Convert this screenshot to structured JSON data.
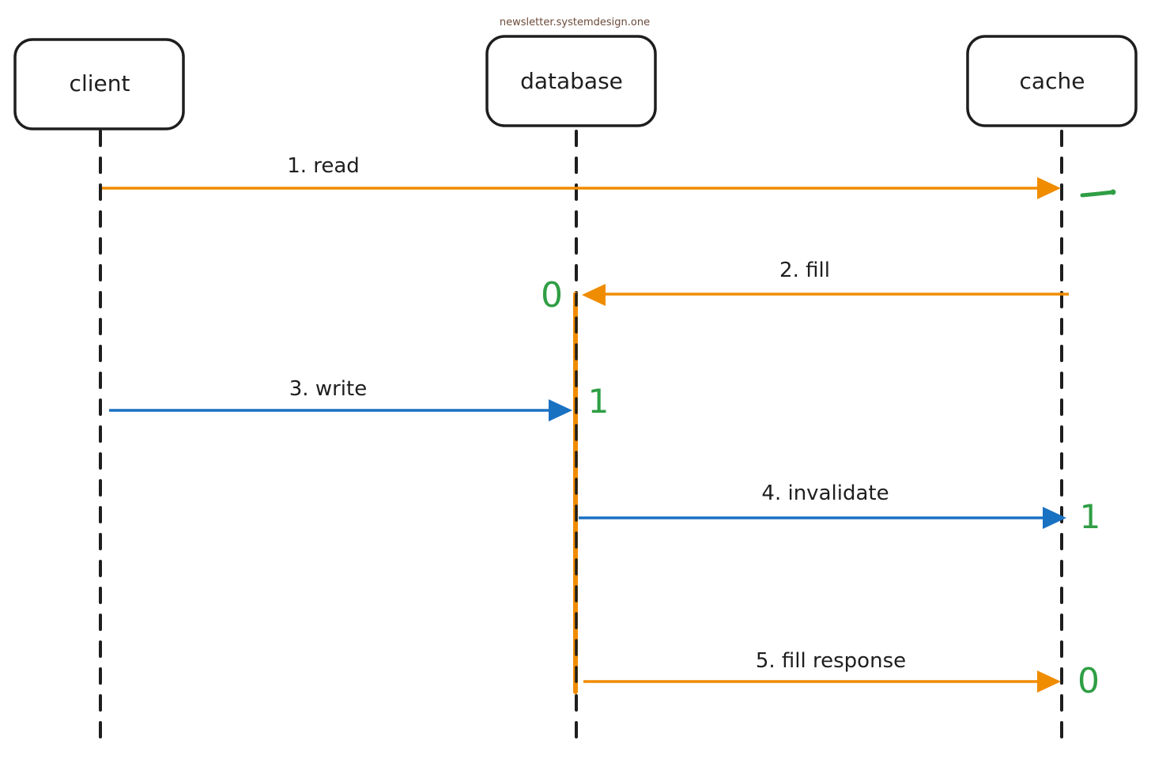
{
  "watermark": "newsletter.systemdesign.one",
  "colors": {
    "orange": "#f08c00",
    "blue": "#1971c2",
    "green": "#2f9e44",
    "black": "#1e1e1e",
    "watermark": "#6b4a3a"
  },
  "participants": [
    {
      "id": "client",
      "label": "client"
    },
    {
      "id": "database",
      "label": "database"
    },
    {
      "id": "cache",
      "label": "cache"
    }
  ],
  "messages": [
    {
      "label": "1. read",
      "from": "client",
      "to": "cache",
      "color": "orange"
    },
    {
      "label": "2. fill",
      "from": "cache",
      "to": "database",
      "color": "orange"
    },
    {
      "label": "3. write",
      "from": "client",
      "to": "database",
      "color": "blue"
    },
    {
      "label": "4. invalidate",
      "from": "database",
      "to": "cache",
      "color": "blue"
    },
    {
      "label": "5. fill response",
      "from": "database",
      "to": "cache",
      "color": "orange"
    }
  ],
  "markers": [
    {
      "label": "–",
      "near": "cache-read"
    },
    {
      "label": "0",
      "near": "database-fill"
    },
    {
      "label": "1",
      "near": "database-write"
    },
    {
      "label": "1",
      "near": "cache-invalidate"
    },
    {
      "label": "0",
      "near": "cache-fill-response"
    }
  ]
}
